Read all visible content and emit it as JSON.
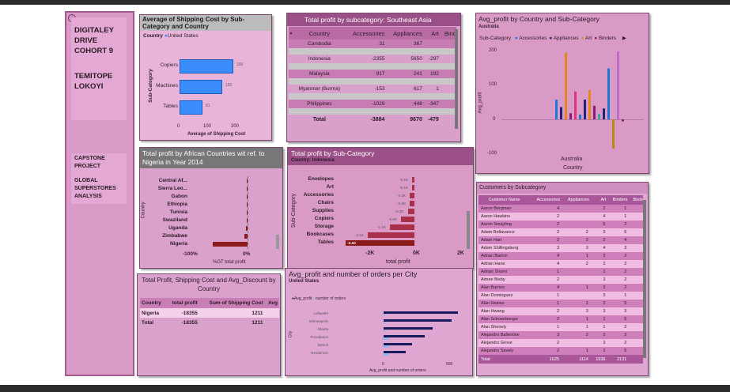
{
  "sidebar": {
    "org": "DIGITALEY DRIVE COHORT 9",
    "author": "TEMITOPE LOKOYI",
    "project": "CAPSTONE PROJECT",
    "analysis": "GLOBAL SUPERSTORES ANALYSIS"
  },
  "ship_cost": {
    "title": "Average of Shipping Cost by Sub-Category and Country",
    "legend_label": "Country",
    "legend_item": "United States",
    "ylabel": "Sub-Category",
    "xlabel": "Average of Shipping Cost",
    "rows": [
      {
        "label": "Copiers",
        "value": "188"
      },
      {
        "label": "Machines",
        "value": "150"
      },
      {
        "label": "Tables",
        "value": "81"
      }
    ],
    "ticks": [
      "0",
      "100",
      "200"
    ]
  },
  "se_asia": {
    "title": "Total profit by subcategory: Southeast Asia",
    "headers": [
      "Country",
      "Accessories",
      "Appliances",
      "Art",
      "Bind"
    ],
    "rows": [
      [
        "Cambodia",
        "31",
        "367",
        "",
        ""
      ],
      [
        "Indonesia",
        "-2355",
        "5650",
        "-297",
        ""
      ],
      [
        "Malaysia",
        "917",
        "241",
        "192",
        ""
      ],
      [
        "Myanmar (Burma)",
        "-153",
        "617",
        "1",
        ""
      ],
      [
        "Philippines",
        "-1029",
        "448",
        "-347",
        ""
      ]
    ],
    "total": [
      "Total",
      "-3884",
      "9670",
      "-479",
      ""
    ]
  },
  "avg_profit": {
    "title": "Avg_profit by Country and Sub-Category",
    "sub": "Australia",
    "legend_label": "Sub-Category",
    "legend": [
      {
        "name": "Accessories",
        "color": "#1f77d9"
      },
      {
        "name": "Appliances",
        "color": "#22207a"
      },
      {
        "name": "Art",
        "color": "#e08a1e"
      },
      {
        "name": "Binders",
        "color": "#8c1a7a"
      }
    ],
    "yticks": [
      "200",
      "100",
      "0",
      "-100"
    ],
    "ylabel": "Avg_profit",
    "xcat": "Australia",
    "xlabel": "Country"
  },
  "africa": {
    "title": "Total profit by African Countries wit ref. to Nigeria in Year 2014",
    "ylabel": "Country",
    "countries": [
      "Central Af...",
      "Sierra Leo...",
      "Gabon",
      "Ethiopia",
      "Tunisia",
      "Swaziland",
      "Uganda",
      "Zimbabwe",
      "Nigeria"
    ],
    "ticks": [
      "-100%",
      "0%"
    ],
    "xlabel": "%GT total profit"
  },
  "subcat": {
    "title": "Total profit by Sub-Category",
    "sub": "Country: Indonesia",
    "ylabel": "Sub-Category",
    "rows": [
      {
        "label": "Envelopes",
        "value": "-0.1K"
      },
      {
        "label": "Art",
        "value": "-0.1K"
      },
      {
        "label": "Accessories",
        "value": "-0.2K"
      },
      {
        "label": "Chairs",
        "value": "-0.2K"
      },
      {
        "label": "Supplies",
        "value": "-0.3K"
      },
      {
        "label": "Copiers",
        "value": "-0.6K"
      },
      {
        "label": "Storage",
        "value": "-1.1K"
      },
      {
        "label": "Bookcases",
        "value": "-2.1K"
      },
      {
        "label": "Tables",
        "value": "-3.1K"
      }
    ],
    "ticks": [
      "-2K",
      "0K",
      "2K"
    ],
    "xlabel": "total profit"
  },
  "customers": {
    "title": "Customers by Subcategory",
    "headers": [
      "Customer Name",
      "Accessories",
      "Appliances",
      "Art",
      "Binders",
      "Book"
    ],
    "rows": [
      [
        "Aaron Bergman",
        "4",
        "",
        "2",
        "1",
        ""
      ],
      [
        "Aaron Hawkins",
        "2",
        "",
        "4",
        "1",
        ""
      ],
      [
        "Aaron Smayling",
        "2",
        "",
        "5",
        "2",
        ""
      ],
      [
        "Adam Bellavance",
        "2",
        "2",
        "3",
        "6",
        ""
      ],
      [
        "Adam Hart",
        "2",
        "2",
        "2",
        "4",
        ""
      ],
      [
        "Adam Shillingsburg",
        "3",
        "3",
        "4",
        "3",
        ""
      ],
      [
        "Adrian Barton",
        "4",
        "1",
        "3",
        "2",
        ""
      ],
      [
        "Adrian Hane",
        "4",
        "2",
        "2",
        "2",
        ""
      ],
      [
        "Adrian Shami",
        "1",
        "",
        "1",
        "2",
        ""
      ],
      [
        "Aimee Bixby",
        "2",
        "",
        "3",
        "2",
        ""
      ],
      [
        "Alan Barnes",
        "4",
        "1",
        "3",
        "2",
        ""
      ],
      [
        "Alan Dominguez",
        "1",
        "",
        "3",
        "1",
        ""
      ],
      [
        "Alan Haines",
        "1",
        "1",
        "2",
        "5",
        ""
      ],
      [
        "Alan Hwang",
        "2",
        "3",
        "3",
        "3",
        ""
      ],
      [
        "Alan Schoenberger",
        "2",
        "1",
        "1",
        "5",
        ""
      ],
      [
        "Alan Shonely",
        "1",
        "1",
        "1",
        "2",
        ""
      ],
      [
        "Alejandro Ballentine",
        "3",
        "2",
        "2",
        "3",
        ""
      ],
      [
        "Alejandro Grove",
        "2",
        "",
        "3",
        "2",
        ""
      ],
      [
        "Alejandro Savely",
        "2",
        "1",
        "2",
        "5",
        ""
      ]
    ],
    "total": [
      "Total",
      "1625",
      "1114",
      "1936",
      "2131",
      ""
    ]
  },
  "ship_summary": {
    "title": "Total Profit, Shipping Cost and Avg_Discount by Country",
    "headers": [
      "Country",
      "total profit",
      "Sum of Shipping Cost",
      "Avg"
    ],
    "rows": [
      [
        "Nigeria",
        "-18355",
        "1211",
        ""
      ]
    ],
    "total": [
      "Total",
      "-18355",
      "1211",
      ""
    ]
  },
  "city": {
    "title": "Avg_profit and number of orders per City",
    "sub": "United States",
    "legend": [
      "Avg_profit",
      "number of orders"
    ],
    "cities": [
      "Lafayette",
      "Minneapolis",
      "Atlanta",
      "Providence",
      "Detroit",
      "Henderson"
    ],
    "ylabel": "City",
    "ticks": [
      "0",
      "500"
    ],
    "xlabel": "Avg_profit and number of orders"
  }
}
